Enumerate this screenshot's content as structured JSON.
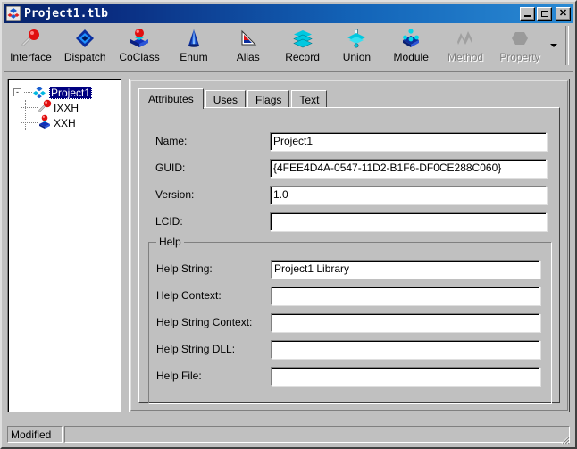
{
  "window": {
    "title": "Project1.tlb",
    "icon": "typelib-icon",
    "buttons": {
      "minimize": "Minimize",
      "maximize": "Maximize",
      "close": "Close"
    }
  },
  "toolbar": {
    "items": [
      {
        "label": "Interface",
        "icon": "interface-icon",
        "disabled": false
      },
      {
        "label": "Dispatch",
        "icon": "dispatch-icon",
        "disabled": false
      },
      {
        "label": "CoClass",
        "icon": "coclass-icon",
        "disabled": false
      },
      {
        "label": "Enum",
        "icon": "enum-icon",
        "disabled": false
      },
      {
        "label": "Alias",
        "icon": "alias-icon",
        "disabled": false
      },
      {
        "label": "Record",
        "icon": "record-icon",
        "disabled": false
      },
      {
        "label": "Union",
        "icon": "union-icon",
        "disabled": false
      },
      {
        "label": "Module",
        "icon": "module-icon",
        "disabled": false
      },
      {
        "label": "Method",
        "icon": "method-icon",
        "disabled": true
      },
      {
        "label": "Property",
        "icon": "property-icon",
        "disabled": true
      }
    ],
    "overflow_icon": "chevron-down-icon"
  },
  "tree": {
    "root": {
      "label": "Project1",
      "icon": "typelib-icon",
      "expanded": true,
      "selected": true,
      "expander": "-"
    },
    "children": [
      {
        "label": "IXXH",
        "icon": "interface-icon"
      },
      {
        "label": "XXH",
        "icon": "coclass-icon"
      }
    ]
  },
  "tabs": [
    {
      "label": "Attributes",
      "active": true
    },
    {
      "label": "Uses",
      "active": false
    },
    {
      "label": "Flags",
      "active": false
    },
    {
      "label": "Text",
      "active": false
    }
  ],
  "attributes": {
    "fields": [
      {
        "label": "Name:",
        "value": "Project1"
      },
      {
        "label": "GUID:",
        "value": "{4FEE4D4A-0547-11D2-B1F6-DF0CE288C060}"
      },
      {
        "label": "Version:",
        "value": "1.0"
      },
      {
        "label": "LCID:",
        "value": ""
      }
    ],
    "help_group": {
      "title": "Help",
      "fields": [
        {
          "label": "Help String:",
          "value": "Project1 Library"
        },
        {
          "label": "Help Context:",
          "value": ""
        },
        {
          "label": "Help String Context:",
          "value": ""
        },
        {
          "label": "Help String DLL:",
          "value": ""
        },
        {
          "label": "Help File:",
          "value": ""
        }
      ]
    }
  },
  "statusbar": {
    "panel1": "Modified",
    "panel2": "",
    "resize_grip": "resize-grip-icon"
  },
  "colors": {
    "face": "#c0c0c0",
    "title_start": "#08246b",
    "title_end": "#2a8ad4",
    "selection": "#000080",
    "accent_red": "#e00000",
    "accent_blue": "#0000c0",
    "accent_cyan": "#00d8e8",
    "disabled": "#808080"
  }
}
